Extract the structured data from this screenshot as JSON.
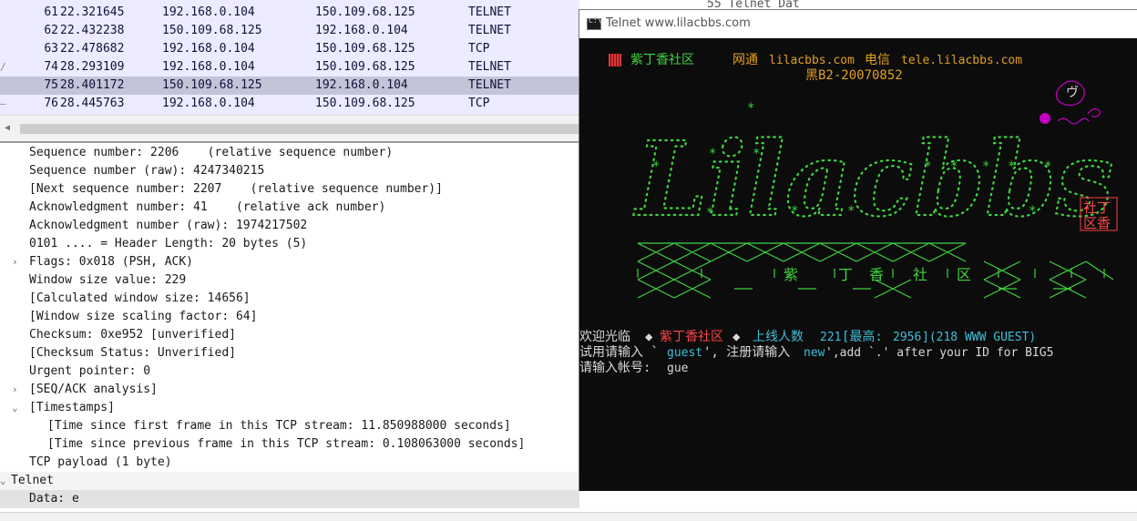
{
  "packets": [
    {
      "no": "61",
      "time": "22.321645",
      "src": "192.168.0.104",
      "dst": "150.109.68.125",
      "proto": "TELNET",
      "marker": "",
      "selected": false
    },
    {
      "no": "62",
      "time": "22.432238",
      "src": "150.109.68.125",
      "dst": "192.168.0.104",
      "proto": "TELNET",
      "marker": "",
      "selected": false
    },
    {
      "no": "63",
      "time": "22.478682",
      "src": "192.168.0.104",
      "dst": "150.109.68.125",
      "proto": "TCP",
      "marker": "",
      "selected": false
    },
    {
      "no": "74",
      "time": "28.293109",
      "src": "192.168.0.104",
      "dst": "150.109.68.125",
      "proto": "TELNET",
      "marker": "/",
      "selected": false
    },
    {
      "no": "75",
      "time": "28.401172",
      "src": "150.109.68.125",
      "dst": "192.168.0.104",
      "proto": "TELNET",
      "marker": "",
      "selected": true
    },
    {
      "no": "76",
      "time": "28.445763",
      "src": "192.168.0.104",
      "dst": "150.109.68.125",
      "proto": "TCP",
      "marker": "—",
      "selected": false
    }
  ],
  "details": [
    {
      "text": "Sequence number: 2206    (relative sequence number)",
      "indent": 1,
      "arrow": ""
    },
    {
      "text": "Sequence number (raw): 4247340215",
      "indent": 1,
      "arrow": ""
    },
    {
      "text": "[Next sequence number: 2207    (relative sequence number)]",
      "indent": 1,
      "arrow": ""
    },
    {
      "text": "Acknowledgment number: 41    (relative ack number)",
      "indent": 1,
      "arrow": ""
    },
    {
      "text": "Acknowledgment number (raw): 1974217502",
      "indent": 1,
      "arrow": ""
    },
    {
      "text": "0101 .... = Header Length: 20 bytes (5)",
      "indent": 1,
      "arrow": ""
    },
    {
      "text": "Flags: 0x018 (PSH, ACK)",
      "indent": 1,
      "arrow": "right"
    },
    {
      "text": "Window size value: 229",
      "indent": 1,
      "arrow": ""
    },
    {
      "text": "[Calculated window size: 14656]",
      "indent": 1,
      "arrow": ""
    },
    {
      "text": "[Window size scaling factor: 64]",
      "indent": 1,
      "arrow": ""
    },
    {
      "text": "Checksum: 0xe952 [unverified]",
      "indent": 1,
      "arrow": ""
    },
    {
      "text": "[Checksum Status: Unverified]",
      "indent": 1,
      "arrow": ""
    },
    {
      "text": "Urgent pointer: 0",
      "indent": 1,
      "arrow": ""
    },
    {
      "text": "[SEQ/ACK analysis]",
      "indent": 1,
      "arrow": "right"
    },
    {
      "text": "[Timestamps]",
      "indent": 1,
      "arrow": "down"
    },
    {
      "text": "[Time since first frame in this TCP stream: 11.850988000 seconds]",
      "indent": 2,
      "arrow": ""
    },
    {
      "text": "[Time since previous frame in this TCP stream: 0.108063000 seconds]",
      "indent": 2,
      "arrow": ""
    },
    {
      "text": "TCP payload (1 byte)",
      "indent": 1,
      "arrow": ""
    }
  ],
  "telnet_section": {
    "label": "Telnet",
    "data_label": "Data: e"
  },
  "behind_window_text": "55 Telnet Dat",
  "telnet_window": {
    "title": "Telnet www.lilacbbs.com",
    "header": {
      "site_name": "紫丁香社区",
      "netcom_label": "网通",
      "netcom_host": "lilacbbs.com",
      "telecom_label": "电信",
      "telecom_host": "tele.lilacbbs.com",
      "license": "黑B2-20070852"
    },
    "banner": {
      "logo_text": "Lilacbbs",
      "seal_top": "社丁",
      "seal_bottom": "区香",
      "decoration_char": "ヴ",
      "pattern_chars": [
        "紫",
        "丁",
        "香",
        "社",
        "区"
      ]
    },
    "welcome": {
      "prefix": "欢迎光临 ",
      "diamond": "◆",
      "site": "紫丁香社区",
      "online_label": "上线人数",
      "online_value": "221",
      "peak_label": "[最高:",
      "peak_value": "2956",
      "guest_info": "](218 WWW GUEST)"
    },
    "hint": {
      "try_prefix": "试用请输入 `",
      "guest_word": "guest",
      "register_prefix": "', 注册请输入 ",
      "new_word": "new",
      "suffix": "',add `.' after your ID for BIG5"
    },
    "prompt": {
      "label": "请输入帐号:",
      "value": "gue"
    }
  },
  "colors": {
    "packet_bg": "#ecebff",
    "selected_bg": "#c4c4d8",
    "terminal_bg": "#0c0c0c",
    "term_green": "#3fd43f",
    "term_orange": "#e0a020",
    "term_red": "#ff4444",
    "term_cyan": "#3fbfd9",
    "term_magenta": "#c400c4",
    "term_white": "#d8d8d8"
  }
}
